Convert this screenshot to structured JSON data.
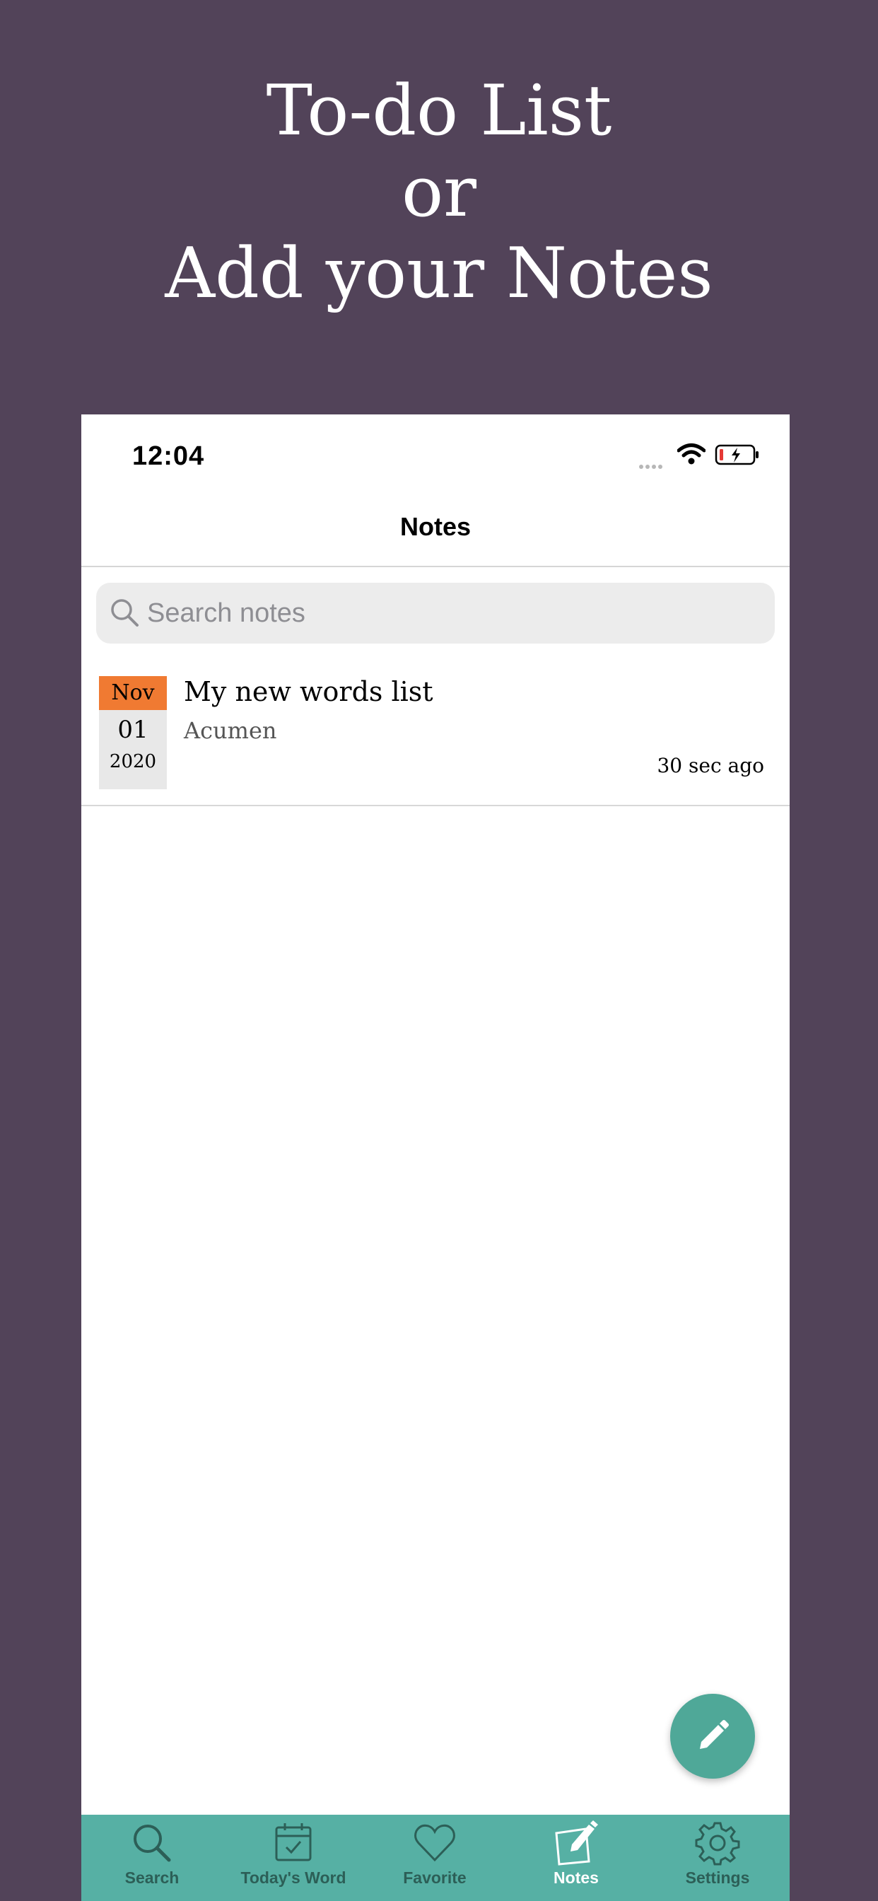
{
  "promo": {
    "line1": "To-do List",
    "line2": "or",
    "line3": "Add your Notes"
  },
  "status_bar": {
    "time": "12:04"
  },
  "nav": {
    "title": "Notes"
  },
  "search": {
    "placeholder": "Search notes"
  },
  "notes": [
    {
      "month": "Nov",
      "day": "01",
      "year": "2020",
      "title": "My new words list",
      "subtitle": "Acumen",
      "time_ago": "30 sec ago"
    }
  ],
  "tabs": [
    {
      "label": "Search",
      "icon": "search-icon"
    },
    {
      "label": "Today's Word",
      "icon": "calendar-check-icon"
    },
    {
      "label": "Favorite",
      "icon": "heart-icon"
    },
    {
      "label": "Notes",
      "icon": "note-pencil-icon",
      "active": true
    },
    {
      "label": "Settings",
      "icon": "gear-icon"
    }
  ],
  "colors": {
    "background": "#524359",
    "accent": "#56b0a4",
    "fab": "#4fa898",
    "date_month": "#f07a32"
  }
}
